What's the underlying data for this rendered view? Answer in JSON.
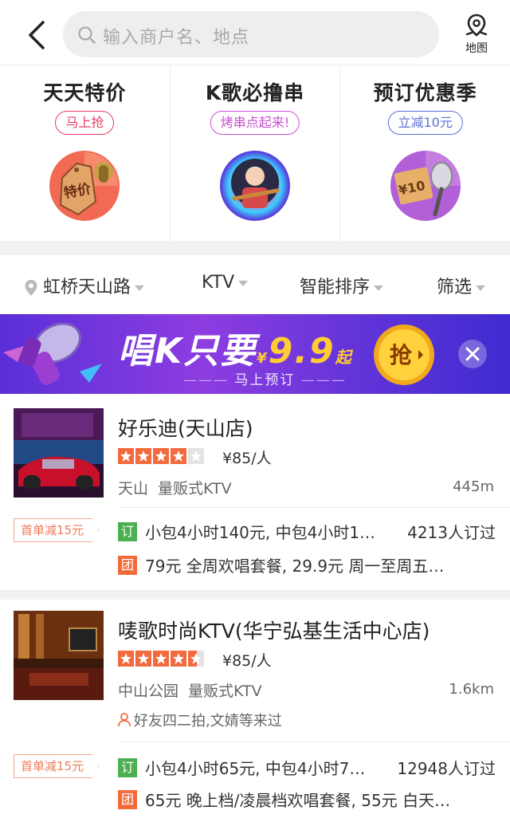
{
  "search": {
    "placeholder": "输入商户名、地点"
  },
  "header": {
    "map_label": "地图"
  },
  "promos": [
    {
      "title": "天天特价",
      "tag": "马上抢",
      "badge_text": "特价"
    },
    {
      "title": "K歌必撸串",
      "tag": "烤串点起来!"
    },
    {
      "title": "预订优惠季",
      "tag": "立减10元",
      "badge_text": "¥10"
    }
  ],
  "filters": {
    "location": "虹桥天山路",
    "category": "KTV",
    "sort": "智能排序",
    "screen": "筛选"
  },
  "banner": {
    "title_prefix": "唱K只要",
    "title_price": "9.9",
    "title_suffix": "起",
    "currency": "¥",
    "subtitle": "马上预订",
    "grab_label": "抢"
  },
  "listings": [
    {
      "name": "好乐迪(天山店)",
      "rating": 4,
      "price": "¥85/人",
      "area": "天山",
      "category": "量贩式KTV",
      "distance": "445m",
      "first_order": "首单减15元",
      "deal_book": {
        "badge": "订",
        "text": "小包4小时140元, 中包4小时1…",
        "count": "4213人订过"
      },
      "deal_group": {
        "badge": "团",
        "text": "79元 全周欢唱套餐, 29.9元 周一至周五…"
      }
    },
    {
      "name": "唛歌时尚KTV(华宁弘基生活中心店)",
      "rating": 4.5,
      "price": "¥85/人",
      "area": "中山公园",
      "category": "量贩式KTV",
      "distance": "1.6km",
      "friends": "好友四二拍,文婧等来过",
      "first_order": "首单减15元",
      "deal_book": {
        "badge": "订",
        "text": "小包4小时65元, 中包4小时7…",
        "count": "12948人订过"
      },
      "deal_group": {
        "badge": "团",
        "text": "65元 晚上档/凌晨档欢唱套餐, 55元 白天…"
      }
    }
  ],
  "colors": {
    "accent": "#f26a3d",
    "banner": "#6a34dc",
    "tag_red": "#ec3b63"
  }
}
